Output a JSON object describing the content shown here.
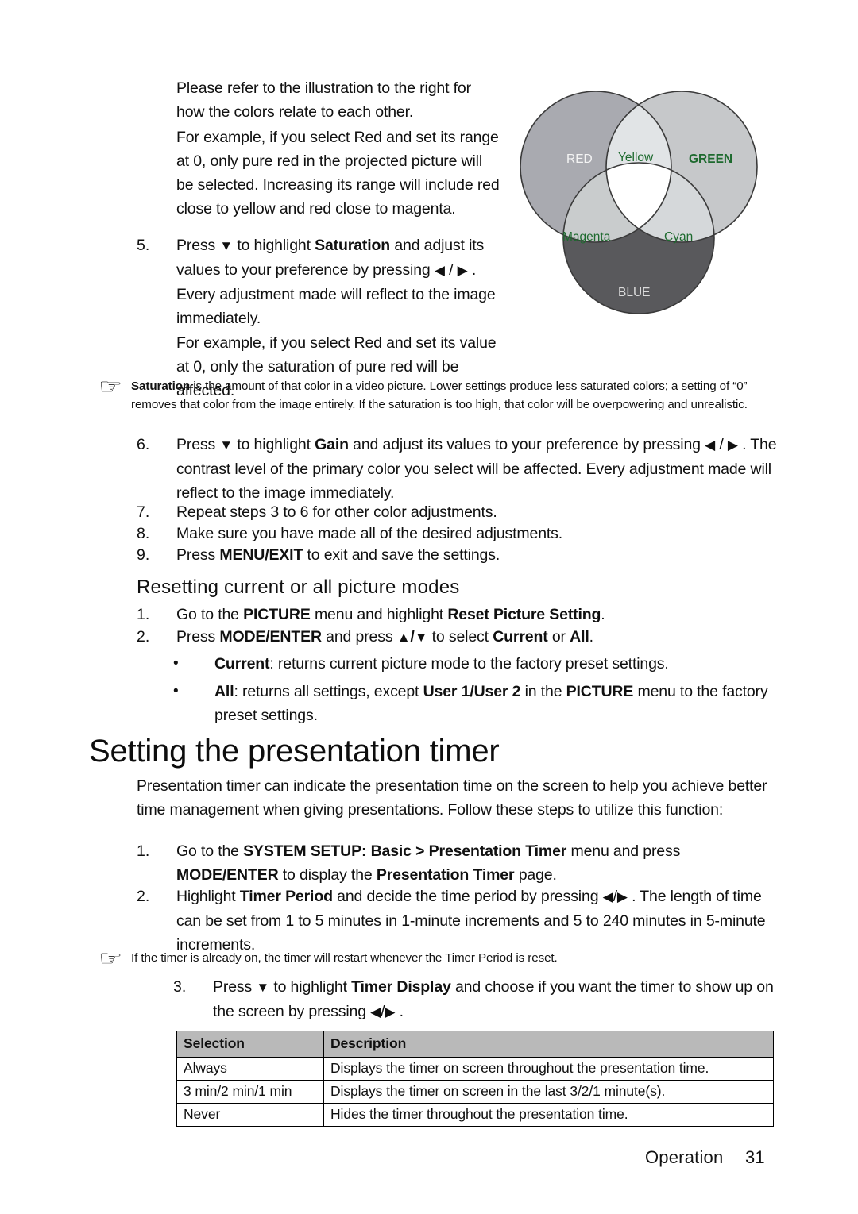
{
  "document": {
    "page_number": "31",
    "footer_section": "Operation"
  },
  "intro": {
    "p1": "Please refer to the illustration to the right for how the colors relate to each other.",
    "p2": "For example, if you select Red and set its range at 0, only pure red in the projected picture will be selected. Increasing its range will include red close to yellow and red close to magenta."
  },
  "step5": {
    "number": "5.",
    "text_a": "Press ",
    "arrow_down": "▼",
    "text_b": " to highlight ",
    "bold_a": "Saturation",
    "text_c": " and adjust its values to your preference by pressing ",
    "arrow_left": "◀",
    "slash": " / ",
    "arrow_right": "▶",
    "text_d": " . Every adjustment made will reflect to the image immediately."
  },
  "step5_example": "For example, if you select Red and set its value at 0, only the saturation of pure red will be affected.",
  "note1": {
    "icon": "pointing-hand-icon",
    "bold_lead": "Saturation",
    "text": " is the amount of that color in a video picture. Lower settings produce less saturated colors; a setting of “0” removes that color from the image entirely. If the saturation is too high, that color will be overpowering and unrealistic."
  },
  "step6": {
    "number": "6.",
    "text_a": "Press ",
    "arrow_down": "▼",
    "text_b": " to highlight ",
    "bold_a": "Gain",
    "text_c": " and adjust its values to your preference by pressing ",
    "arrow_left": "◀",
    "slash": " / ",
    "arrow_right": "▶",
    "text_d": " . The contrast level of the primary color you select will be affected. Every adjustment made will reflect to the image immediately."
  },
  "step7": {
    "number": "7.",
    "text": "Repeat steps 3 to 6 for other color adjustments."
  },
  "step8": {
    "number": "8.",
    "text": "Make sure you have made all of the desired adjustments."
  },
  "step9": {
    "number": "9.",
    "text_a": "Press ",
    "bold_a": "MENU/EXIT",
    "text_b": " to exit and save the settings."
  },
  "heading_reset": "Resetting current or all picture modes",
  "reset_step1": {
    "number": "1.",
    "text_a": "Go to the ",
    "bold_a": "PICTURE",
    "text_b": " menu and highlight ",
    "bold_b": "Reset Picture Setting",
    "text_c": "."
  },
  "reset_step2": {
    "number": "2.",
    "text_a": "Press ",
    "bold_a": "MODE/ENTER",
    "text_b": " and press ",
    "arrow_up": "▲",
    "slash": "/",
    "arrow_down": "▼",
    "text_c": " to select ",
    "bold_b": "Current",
    "text_d": " or ",
    "bold_c": "All",
    "text_e": "."
  },
  "reset_bullets": [
    {
      "marker": "•",
      "bold_a": "Current",
      "text_a": ": returns current picture mode to the factory preset settings."
    },
    {
      "marker": "•",
      "bold_a": "All",
      "text_a": ": returns all settings, except ",
      "bold_b": "User 1/User 2",
      "text_b": " in the ",
      "bold_c": "PICTURE",
      "text_c": " menu to the factory preset settings."
    }
  ],
  "heading_timer": "Setting the presentation timer",
  "timer_intro": "Presentation timer can indicate the presentation time on the screen to help you achieve better time management when giving presentations. Follow these steps to utilize this function:",
  "timer_step1": {
    "number": "1.",
    "text_a": "Go to the ",
    "bold_a": "SYSTEM SETUP: Basic > Presentation Timer",
    "text_b": " menu and press ",
    "bold_b": "MODE/ENTER",
    "text_c": " to display the ",
    "bold_c": "Presentation Timer",
    "text_d": " page."
  },
  "timer_step2": {
    "number": "2.",
    "text_a": "Highlight ",
    "bold_a": "Timer Period",
    "text_b": " and decide the time period by pressing ",
    "arrow_left": "◀",
    "slash": "/",
    "arrow_right": "▶",
    "text_c": " . The length of time can be set from 1 to 5 minutes in 1-minute increments and 5 to 240 minutes in 5-minute increments."
  },
  "note2": {
    "icon": "pointing-hand-icon",
    "text": "If the timer is already on, the timer will restart whenever the Timer Period is reset."
  },
  "timer_step3": {
    "number": "3.",
    "text_a": "Press ",
    "arrow_down": "▼",
    "text_b": " to highlight ",
    "bold_a": "Timer Display",
    "text_c": " and choose if you want the timer to show up on the screen by pressing ",
    "arrow_left": "◀",
    "slash": "/",
    "arrow_right": "▶",
    "text_d": " ."
  },
  "table": {
    "headers": [
      "Selection",
      "Description"
    ],
    "rows": [
      [
        "Always",
        "Displays the timer on screen throughout the presentation time."
      ],
      [
        "3 min/2 min/1 min",
        "Displays the timer on screen in the last 3/2/1 minute(s)."
      ],
      [
        "Never",
        "Hides the timer throughout the presentation time."
      ]
    ]
  },
  "venn": {
    "labels": {
      "red": "RED",
      "green": "GREEN",
      "blue": "BLUE",
      "yellow": "Yellow",
      "magenta": "Magenta",
      "cyan": "Cyan"
    },
    "colors": {
      "red_fill": "#a9aab0",
      "green_fill": "#c6c8ca",
      "blue_fill": "#59595c",
      "overlap_light": "#d5d8da",
      "stroke": "#333333",
      "label_light": "#f2f2f2",
      "label_green": "#1d6a2e"
    }
  }
}
